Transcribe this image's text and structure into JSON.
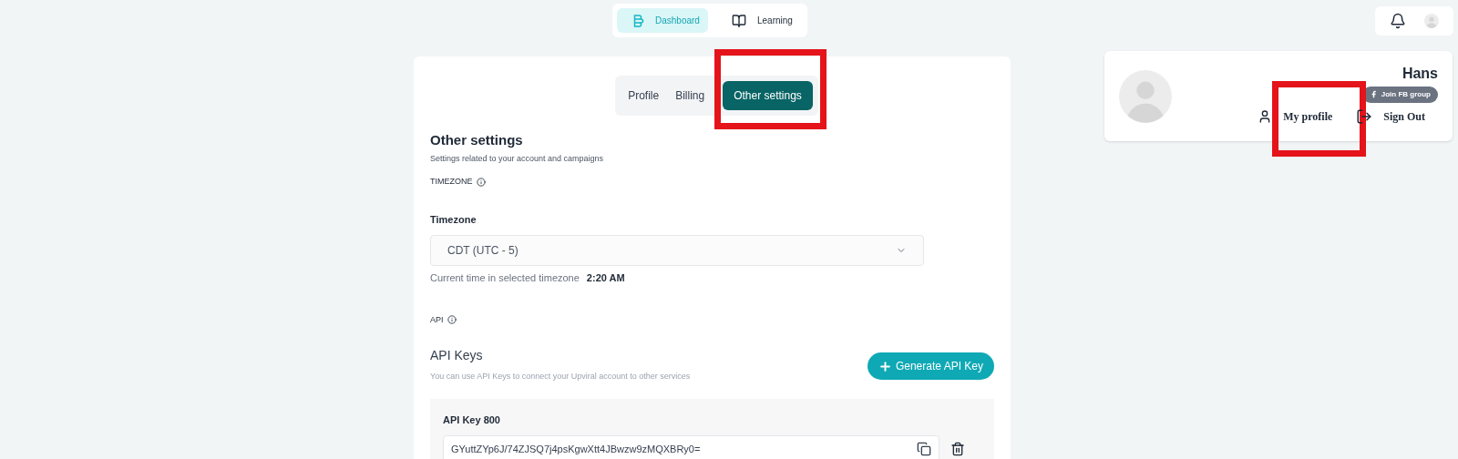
{
  "nav": [
    {
      "label": "Dashboard",
      "selected": true
    },
    {
      "label": "Learning",
      "selected": false
    }
  ],
  "profile_menu": {
    "name": "Hans",
    "badge": "Join FB group",
    "actions": [
      {
        "label": "My profile",
        "highlighted": true
      },
      {
        "label": "Sign Out",
        "highlighted": false
      }
    ]
  },
  "tabs": [
    {
      "label": "Profile",
      "selected": false,
      "highlighted": false
    },
    {
      "label": "Billing",
      "selected": false,
      "highlighted": false
    },
    {
      "label": "Other settings",
      "selected": true,
      "highlighted": true
    }
  ],
  "heading": "Other settings",
  "subheading": "Settings related to your account and campaigns",
  "timezone_section": {
    "title": "TIMEZONE",
    "field_label": "Timezone",
    "value": "CDT (UTC - 5)",
    "current_label": "Current time in selected timezone",
    "current_time": "2:20 AM"
  },
  "api_section": {
    "title": "API",
    "heading": "API Keys",
    "description": "You can use API Keys to connect your Upviral account to other services",
    "button": "Generate API Key",
    "keys": [
      {
        "name": "API Key 800",
        "value": "GYuttZYp6J/74ZJSQ7j4psKgwXtt4JBwzw9zMQXBRy0="
      }
    ]
  }
}
